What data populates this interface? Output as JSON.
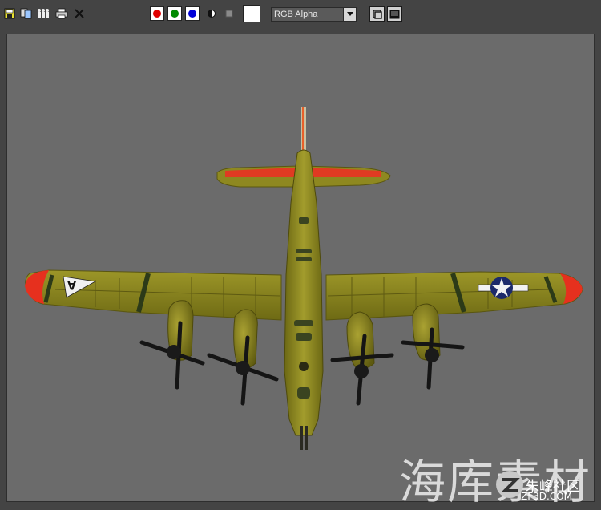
{
  "toolbar": {
    "icons": [
      "save-icon",
      "clone-icon",
      "users-icon",
      "print-icon",
      "clear-icon"
    ],
    "channels": [
      {
        "name": "red",
        "color": "#e00000"
      },
      {
        "name": "green",
        "color": "#008a00"
      },
      {
        "name": "blue",
        "color": "#0000d8"
      }
    ],
    "channel_select": {
      "selected": "RGB Alpha"
    }
  },
  "watermark": {
    "main_text": "海库素材",
    "sub_text": "朱峰社区",
    "url": "ZF3D.COM"
  },
  "colors": {
    "background": "#444444",
    "viewport": "#6b6b6b",
    "plane_body": "#8a8420",
    "plane_accent": "#e83020"
  }
}
